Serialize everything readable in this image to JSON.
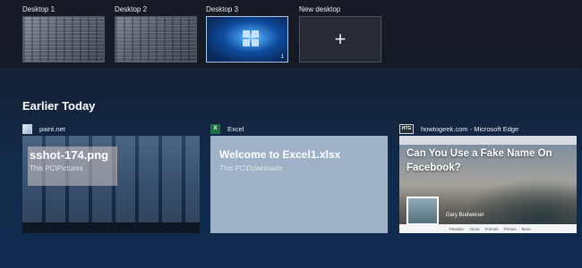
{
  "desktops": [
    {
      "label": "Desktop 1"
    },
    {
      "label": "Desktop 2"
    },
    {
      "label": "Desktop 3",
      "badge": "1"
    },
    {
      "label": "New desktop",
      "icon": "plus-icon"
    }
  ],
  "timeline": {
    "section_title": "Earlier Today"
  },
  "windows": [
    {
      "app": "paint.net",
      "title": "sshot-174.png",
      "path": "This PC\\Pictures"
    },
    {
      "app": "Excel",
      "icon_letter": "X",
      "title": "Welcome to Excel1.xlsx",
      "path": "This PC\\Downloads"
    },
    {
      "app": "howtogeek.com - Microsoft Edge",
      "icon_letter": "HTG",
      "title": "Can You Use a Fake Name On Facebook?",
      "profile_name": "Gary Budweiser",
      "tabs": [
        "Timeline",
        "About",
        "Friends",
        "Photos",
        "More"
      ]
    }
  ],
  "colors": {
    "excel_icon": "#1e7145",
    "active_border": "#a9c6e6"
  }
}
